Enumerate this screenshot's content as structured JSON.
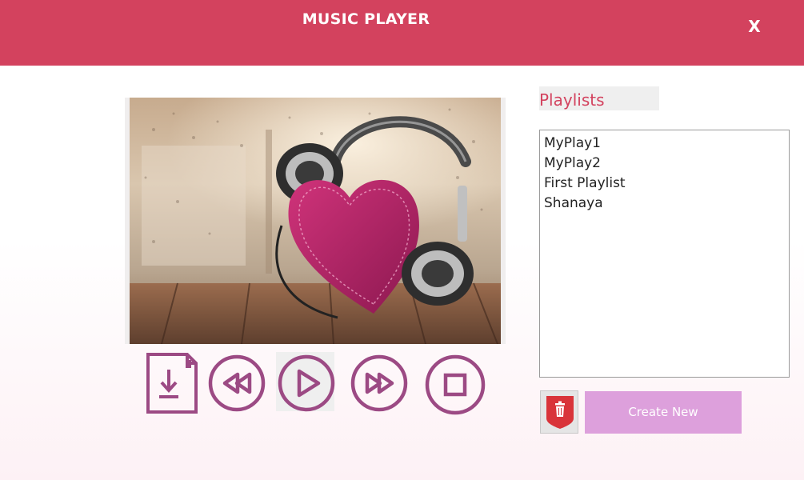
{
  "window": {
    "title": "MUSIC PLAYER",
    "close_label": "X",
    "accent_color": "#d3425e"
  },
  "artwork": {
    "subject": "pink heart with headphones"
  },
  "controls": {
    "icon_color": "#9c4a84",
    "buttons": [
      {
        "name": "import-icon"
      },
      {
        "name": "rewind-icon"
      },
      {
        "name": "play-icon"
      },
      {
        "name": "fast-forward-icon"
      },
      {
        "name": "stop-icon"
      }
    ]
  },
  "playlists": {
    "label": "Playlists",
    "items": [
      "MyPlay1",
      "MyPlay2",
      "First Playlist",
      "Shanaya"
    ],
    "delete_icon": "trash-icon",
    "create_label": "Create New",
    "create_color": "#dda0dc"
  }
}
